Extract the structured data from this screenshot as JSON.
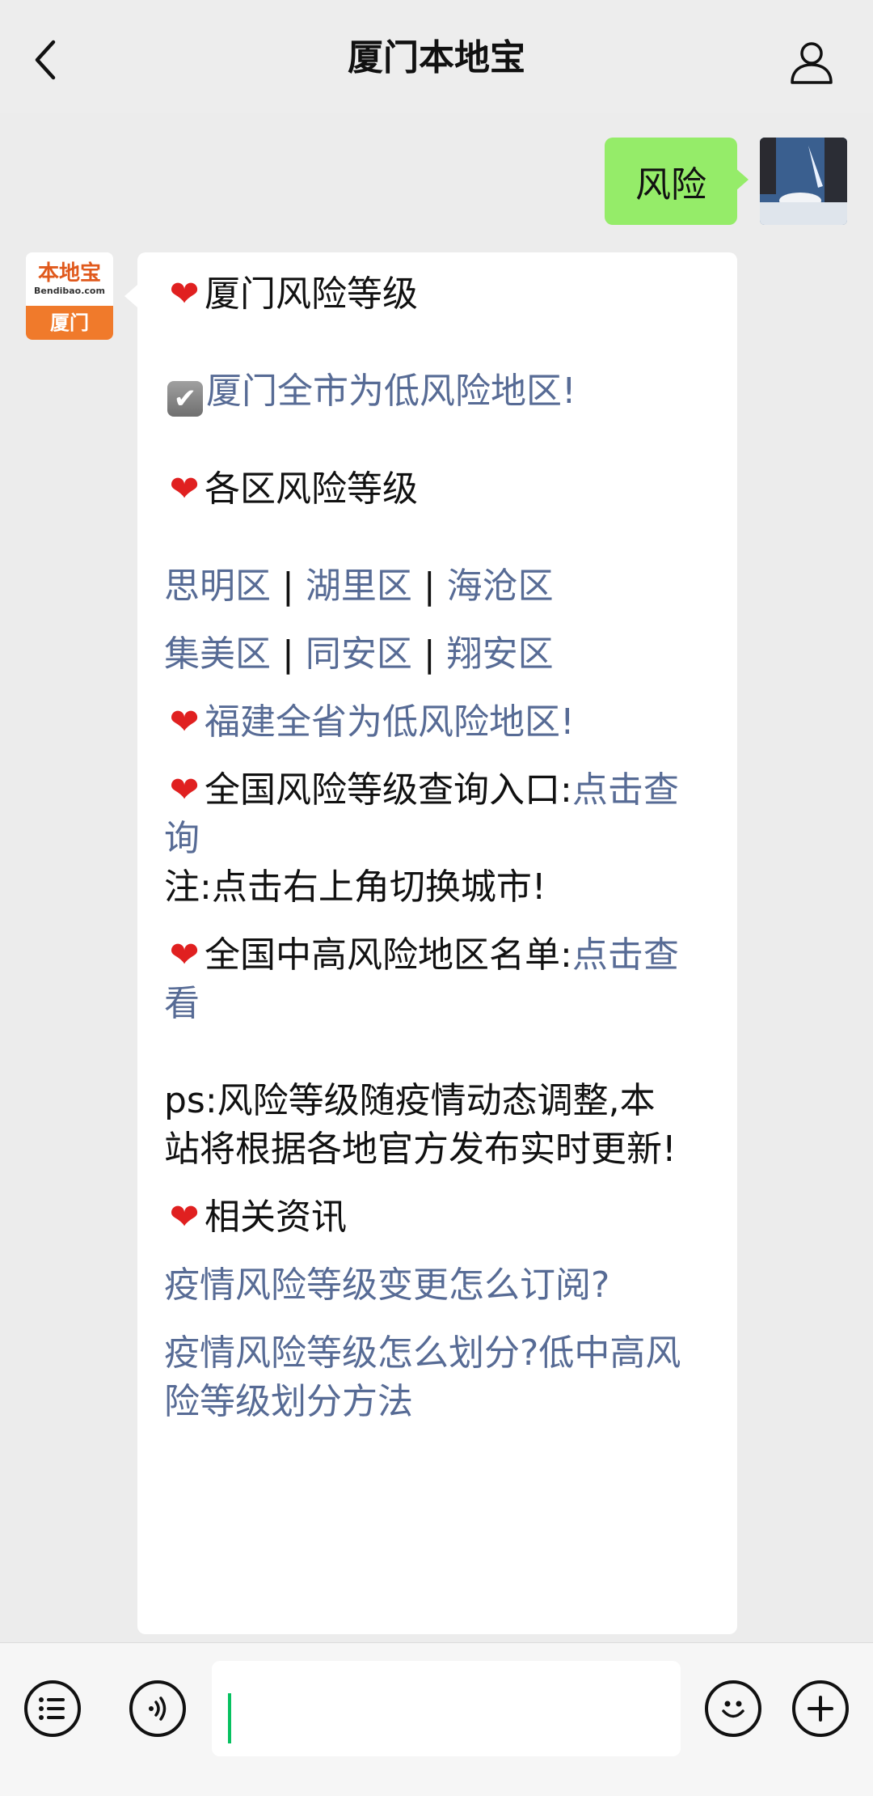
{
  "header": {
    "title": "厦门本地宝",
    "back_icon": "chevron-left-icon",
    "profile_icon": "person-icon"
  },
  "user_message": {
    "text": "风险"
  },
  "bot": {
    "avatar_text_cn": "本地宝",
    "avatar_text_en": "Bendibao.com",
    "avatar_city": "厦门",
    "heading_xiamen": "厦门风险等级",
    "xiamen_low": "厦门全市为低风险地区!",
    "heading_districts": "各区风险等级",
    "districts_row1": [
      "思明区",
      "湖里区",
      "海沧区"
    ],
    "districts_row2": [
      "集美区",
      "同安区",
      "翔安区"
    ],
    "separator": "|",
    "fujian_low": "福建全省为低风险地区!",
    "national_query_label": "全国风险等级查询入口:",
    "national_query_link_1": "点击查",
    "national_query_link_2": "询",
    "note": "注:点击右上角切换城市!",
    "mid_high_label": "全国中高风险地区名单:",
    "mid_high_link_1": "点击查",
    "mid_high_link_2": "看",
    "ps_line1": "ps:风险等级随疫情动态调整,本",
    "ps_line2": "站将根据各地官方发布实时更新!",
    "related_heading": "相关资讯",
    "related_link1": "疫情风险等级变更怎么订阅?",
    "related_link2_line1": "疫情风险等级怎么划分?低中高风",
    "related_link2_line2": "险等级划分方法"
  },
  "input_bar": {
    "menu_icon": "list-menu-icon",
    "voice_icon": "voice-icon",
    "emoji_icon": "smiley-icon",
    "plus_icon": "plus-icon",
    "input_value": ""
  },
  "colors": {
    "link": "#576b95",
    "user_bubble": "#95ec69",
    "background": "#ececec",
    "caret": "#07c160"
  }
}
